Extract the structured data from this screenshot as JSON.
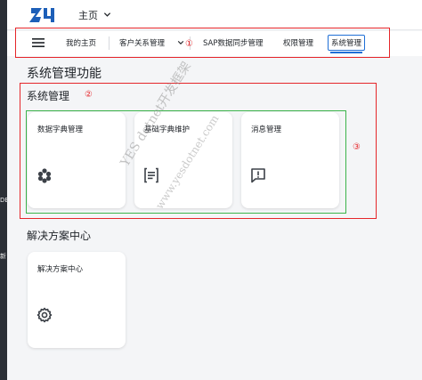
{
  "desktop": {
    "fragment_1": "DE",
    "fragment_2": "新"
  },
  "header": {
    "title": "主页"
  },
  "nav": {
    "items": [
      {
        "label": "我的主页"
      },
      {
        "label": "客户关系管理"
      },
      {
        "label": "SAP数据同步管理"
      },
      {
        "label": "权限管理"
      },
      {
        "label": "系统管理"
      }
    ],
    "active_index": 4
  },
  "page": {
    "title": "系统管理功能",
    "section_1": {
      "title": "系统管理",
      "cards": [
        {
          "label": "数据字典管理",
          "icon": "cube-icon"
        },
        {
          "label": "基础字典维护",
          "icon": "document-list-icon"
        },
        {
          "label": "消息管理",
          "icon": "message-alert-icon"
        }
      ]
    },
    "section_2": {
      "title": "解决方案中心",
      "cards": [
        {
          "label": "解决方案中心",
          "icon": "gear-icon"
        }
      ]
    }
  },
  "annotations": {
    "mark_1": "①",
    "mark_2": "②",
    "mark_3": "③"
  },
  "watermark": {
    "line_1": "YES dotnet开发框架",
    "line_2": "www.yesdotnet.com"
  },
  "colors": {
    "accent": "#1f6fd6",
    "annotation_red": "#e5262a",
    "annotation_green": "#3cb44b",
    "logo_blue": "#1d5fb8"
  }
}
